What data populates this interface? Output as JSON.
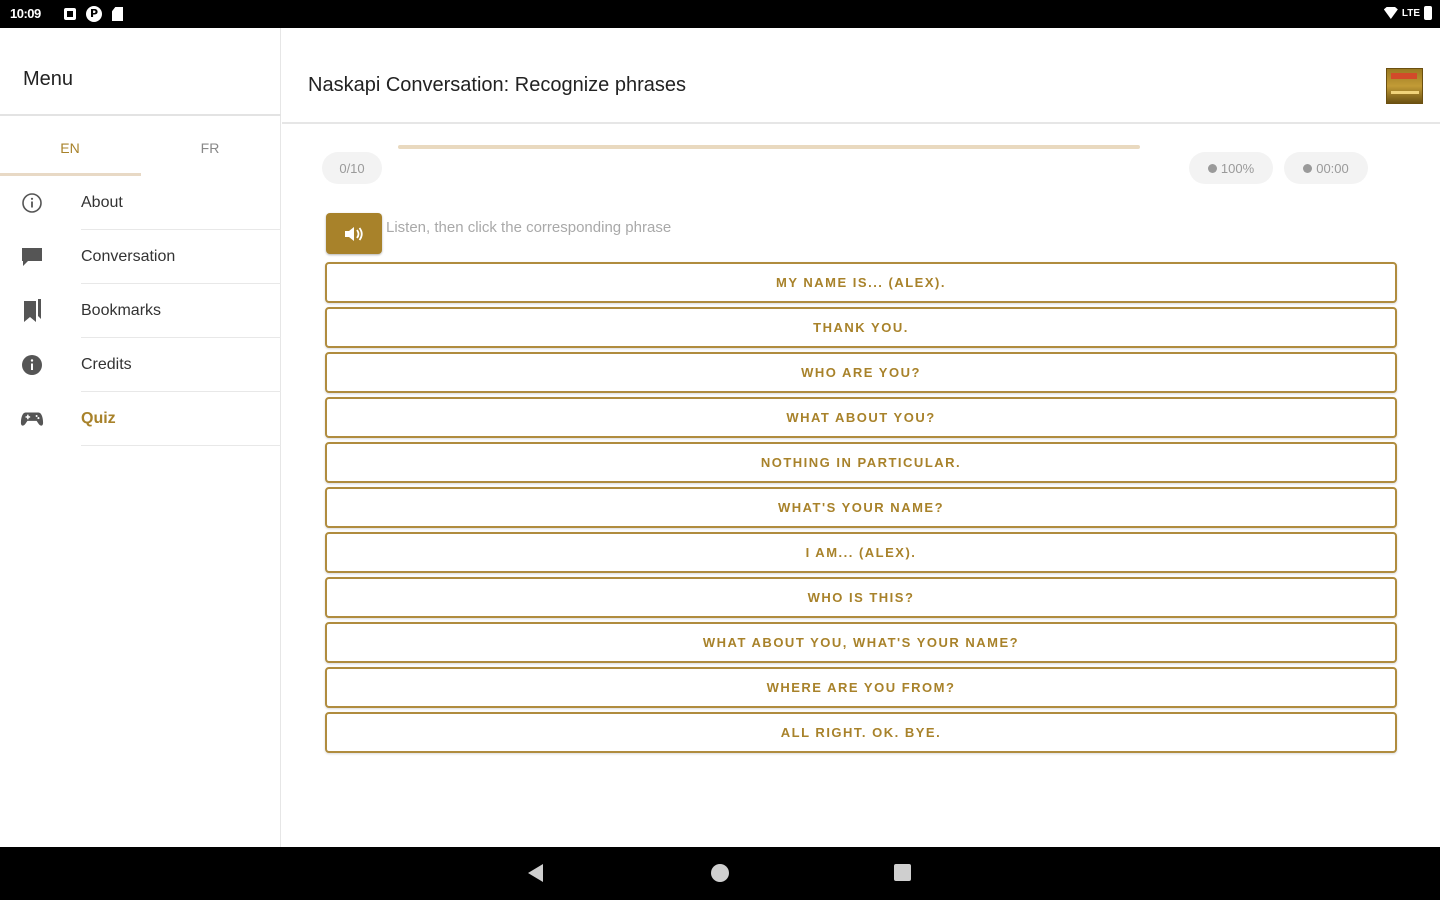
{
  "status_bar": {
    "time": "10:09",
    "network": "LTE",
    "icons": [
      "notification-square-icon",
      "app-p-icon",
      "sd-card-icon",
      "wifi-icon",
      "battery-icon"
    ]
  },
  "sidebar": {
    "title": "Menu",
    "lang_tabs": [
      {
        "label": "EN",
        "active": true
      },
      {
        "label": "FR",
        "active": false
      }
    ],
    "items": [
      {
        "label": "About",
        "icon": "info-outline-icon",
        "active": false
      },
      {
        "label": "Conversation",
        "icon": "chat-bubble-icon",
        "active": false
      },
      {
        "label": "Bookmarks",
        "icon": "bookmarks-icon",
        "active": false
      },
      {
        "label": "Credits",
        "icon": "info-filled-icon",
        "active": false
      },
      {
        "label": "Quiz",
        "icon": "gamepad-icon",
        "active": true
      }
    ]
  },
  "header": {
    "title": "Naskapi Conversation: Recognize phrases",
    "logo": "naskapi-logo"
  },
  "quiz": {
    "progress_label": "0/10",
    "progress_fraction": 0,
    "score": "100%",
    "timer": "00:00",
    "instruction": "Listen, then click the corresponding phrase",
    "options": [
      "MY NAME IS... (ALEX).",
      "THANK YOU.",
      "WHO ARE YOU?",
      "WHAT ABOUT YOU?",
      "NOTHING IN PARTICULAR.",
      "WHAT'S YOUR NAME?",
      "I AM... (ALEX).",
      "WHO IS THIS?",
      "WHAT ABOUT YOU, WHAT'S YOUR NAME?",
      "WHERE ARE YOU FROM?",
      "ALL RIGHT. OK. BYE."
    ]
  },
  "colors": {
    "accent": "#a8822a",
    "option_border": "#b08c3e",
    "progress_track": "#e9d9bf",
    "muted_text": "#a9a9a9"
  }
}
